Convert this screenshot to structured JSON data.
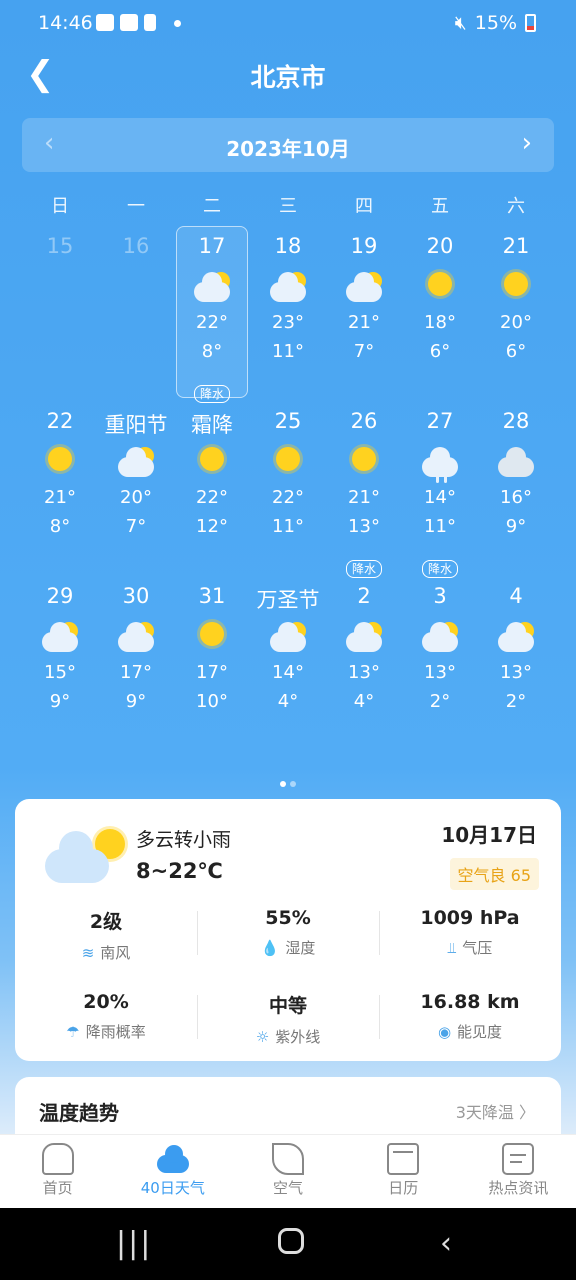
{
  "status_bar": {
    "time": "14:46",
    "battery": "15%"
  },
  "header": {
    "title": "北京市"
  },
  "month_bar": {
    "label": "2023年10月"
  },
  "weekdays": [
    "日",
    "一",
    "二",
    "三",
    "四",
    "五",
    "六"
  ],
  "calendar": [
    [
      {
        "label": "15",
        "muted": true
      },
      {
        "label": "16",
        "muted": true
      },
      {
        "label": "17",
        "icon": "partly-cloudy",
        "hi": "22°",
        "lo": "8°",
        "rain": "降水",
        "selected": true
      },
      {
        "label": "18",
        "icon": "partly-cloudy",
        "hi": "23°",
        "lo": "11°"
      },
      {
        "label": "19",
        "icon": "partly-cloudy",
        "hi": "21°",
        "lo": "7°"
      },
      {
        "label": "20",
        "icon": "sunny",
        "hi": "18°",
        "lo": "6°"
      },
      {
        "label": "21",
        "icon": "sunny",
        "hi": "20°",
        "lo": "6°"
      }
    ],
    [
      {
        "label": "22",
        "icon": "sunny",
        "hi": "21°",
        "lo": "8°"
      },
      {
        "label": "重阳节",
        "icon": "partly-cloudy",
        "hi": "20°",
        "lo": "7°"
      },
      {
        "label": "霜降",
        "icon": "sunny",
        "hi": "22°",
        "lo": "12°"
      },
      {
        "label": "25",
        "icon": "sunny",
        "hi": "22°",
        "lo": "11°"
      },
      {
        "label": "26",
        "icon": "sunny",
        "hi": "21°",
        "lo": "13°",
        "rain": "降水"
      },
      {
        "label": "27",
        "icon": "rain",
        "hi": "14°",
        "lo": "11°",
        "rain": "降水"
      },
      {
        "label": "28",
        "icon": "cloudy",
        "hi": "16°",
        "lo": "9°"
      }
    ],
    [
      {
        "label": "29",
        "icon": "partly-cloudy",
        "hi": "15°",
        "lo": "9°"
      },
      {
        "label": "30",
        "icon": "partly-cloudy",
        "hi": "17°",
        "lo": "9°"
      },
      {
        "label": "31",
        "icon": "sunny",
        "hi": "17°",
        "lo": "10°"
      },
      {
        "label": "万圣节",
        "icon": "partly-cloudy",
        "hi": "14°",
        "lo": "4°"
      },
      {
        "label": "2",
        "icon": "partly-cloudy",
        "hi": "13°",
        "lo": "4°"
      },
      {
        "label": "3",
        "icon": "partly-cloudy",
        "hi": "13°",
        "lo": "2°"
      },
      {
        "label": "4",
        "icon": "partly-cloudy",
        "hi": "13°",
        "lo": "2°"
      }
    ]
  ],
  "detail": {
    "condition": "多云转小雨",
    "range": "8~22℃",
    "date": "10月17日",
    "aqi": "空气良 65",
    "stats": [
      [
        {
          "value": "2级",
          "label": "南风",
          "icon": "≋"
        },
        {
          "value": "55%",
          "label": "湿度",
          "icon": "💧"
        },
        {
          "value": "1009 hPa",
          "label": "气压",
          "icon": "⫫"
        }
      ],
      [
        {
          "value": "20%",
          "label": "降雨概率",
          "icon": "☂"
        },
        {
          "value": "中等",
          "label": "紫外线",
          "icon": "☼"
        },
        {
          "value": "16.88 km",
          "label": "能见度",
          "icon": "◉"
        }
      ]
    ]
  },
  "trend": {
    "title": "温度趋势",
    "summary": "3天降温 〉"
  },
  "nav": [
    {
      "label": "首页",
      "icon": "home-icon",
      "cls": "ni-home"
    },
    {
      "label": "40日天气",
      "icon": "cloud-icon",
      "cls": "ni-cloud",
      "active": true
    },
    {
      "label": "空气",
      "icon": "leaf-icon",
      "cls": "ni-leaf"
    },
    {
      "label": "日历",
      "icon": "calendar-icon",
      "cls": "ni-cal"
    },
    {
      "label": "热点资讯",
      "icon": "news-icon",
      "cls": "ni-news"
    }
  ]
}
